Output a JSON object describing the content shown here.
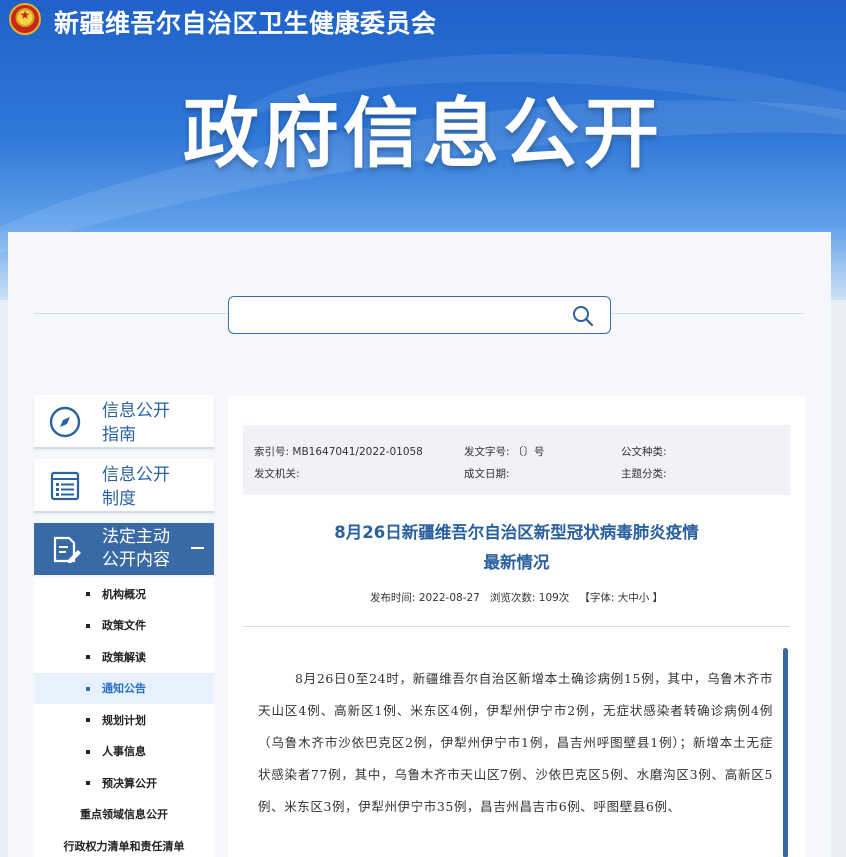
{
  "header": {
    "site_name": "新疆维吾尔自治区卫生健康委员会",
    "section_title": "政府信息公开"
  },
  "search": {
    "placeholder": "",
    "value": ""
  },
  "sidebar": {
    "cards": [
      {
        "label_line1": "信息公开",
        "label_line2": "指南",
        "icon": "compass-icon"
      },
      {
        "label_line1": "信息公开",
        "label_line2": "制度",
        "icon": "list-icon"
      }
    ],
    "active": {
      "label_line1": "法定主动",
      "label_line2": "公开内容",
      "icon": "edit-document-icon"
    },
    "submenu": [
      "机构概况",
      "政策文件",
      "政策解读",
      "通知公告",
      "规划计划",
      "人事信息",
      "预决算公开"
    ],
    "active_index": 3,
    "extra_links": [
      "重点领域信息公开",
      "行政权力清单和责任清单"
    ]
  },
  "meta": {
    "index_label": "索引号:",
    "index_value": "MB1647041/2022-01058",
    "doc_no_label": "发文字号:",
    "doc_no_value": "〔〕号",
    "doc_type_label": "公文种类:",
    "issuer_label": "发文机关:",
    "date_label": "成文日期:",
    "topic_label": "主题分类:"
  },
  "article": {
    "title_line1": "8月26日新疆维吾尔自治区新型冠状病毒肺炎疫情",
    "title_line2": "最新情况",
    "pub_label": "发布时间:",
    "pub_date": "2022-08-27",
    "views_label": "浏览次数:",
    "views": "109次",
    "font_label": "【字体: 大中小 】",
    "body": "8月26日0至24时，新疆维吾尔自治区新增本土确诊病例15例，其中，乌鲁木齐市天山区4例、高新区1例、米东区4例，伊犁州伊宁市2例，无症状感染者转确诊病例4例（乌鲁木齐市沙依巴克区2例，伊犁州伊宁市1例，昌吉州呼图壁县1例）；新增本土无症状感染者77例，其中，乌鲁木齐市天山区7例、沙依巴克区5例、水磨沟区3例、高新区5例、米东区3例，伊犁州伊宁市35例，昌吉州昌吉市6例、呼图壁县6例、"
  },
  "colors": {
    "brand_blue": "#2a62a3",
    "active_bg": "#3a6aa6",
    "title_blue": "#2a5fa0"
  }
}
